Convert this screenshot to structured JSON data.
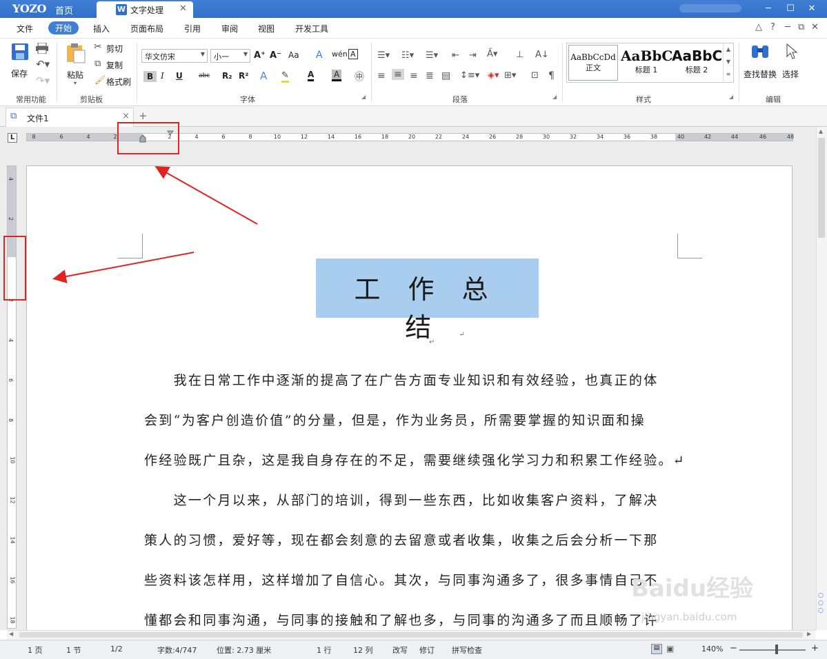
{
  "titlebar": {
    "logo": "YOZO",
    "home": "首页",
    "app_tab": "文字处理",
    "win_min": "─",
    "win_max": "☐",
    "win_close": "✕",
    "w_icon": "W"
  },
  "menubar": {
    "items": [
      "文件",
      "开始",
      "插入",
      "页面布局",
      "引用",
      "审阅",
      "视图",
      "开发工具"
    ],
    "active": "开始",
    "right": [
      "△",
      "?",
      "─",
      "⧉",
      "✕"
    ]
  },
  "ribbon": {
    "common": {
      "save": "保存",
      "group": "常用功能"
    },
    "clipboard": {
      "paste": "粘贴",
      "cut": "剪切",
      "copy": "复制",
      "format_painter": "格式刷",
      "group": "剪贴板"
    },
    "font": {
      "font_name": "华文仿宋",
      "font_size": "小一",
      "group": "字体",
      "bold": "B",
      "italic": "I",
      "underline": "U",
      "strike": "abc",
      "sub": "R₂",
      "sup": "R²",
      "grow": "A⁺",
      "shrink": "A⁻",
      "case": "Aa",
      "pinyin": "wén",
      "border": "A",
      "font_color": "A",
      "highlight": "A",
      "effect": "A"
    },
    "paragraph": {
      "group": "段落"
    },
    "styles": {
      "group": "样式",
      "items": [
        {
          "preview": "AaBbCcDd",
          "name": "正文"
        },
        {
          "preview": "AaBbC",
          "name": "标题 1"
        },
        {
          "preview": "AaBbC",
          "name": "标题 2"
        }
      ]
    },
    "edit": {
      "find": "查找替换",
      "select": "选择",
      "group": "编辑"
    }
  },
  "doctab": {
    "name": "文件1",
    "close": "×",
    "add": "+"
  },
  "ruler": {
    "corner": "L",
    "h_ticks": [
      "8",
      "6",
      "4",
      "2",
      "2",
      "4",
      "6",
      "8",
      "10",
      "12",
      "14",
      "16",
      "18",
      "20",
      "22",
      "24",
      "26",
      "28",
      "30",
      "32",
      "34",
      "36",
      "38",
      "40",
      "42",
      "44",
      "46",
      "48"
    ],
    "v_ticks": [
      "4",
      "2",
      "2",
      "4",
      "6",
      "8",
      "10",
      "12",
      "14",
      "16",
      "18"
    ]
  },
  "document": {
    "title": "工作总结",
    "empty_mark": "↵",
    "lines": [
      "　　我在日常工作中逐渐的提高了在广告方面专业知识和有效经验，也真正的体",
      "会到“为客户创造价值”的分量，但是，作为业务员，所需要掌握的知识面和操",
      "作经验既广且杂，这是我自身存在的不足，需要继续强化学习力和积累工作经验。↵",
      "　　这一个月以来，从部门的培训，得到一些东西，比如收集客户资料，了解决",
      "策人的习惯，爱好等，现在都会刻意的去留意或者收集，收集之后会分析一下那",
      "些资料该怎样用，这样增加了自信心。其次，与同事沟通多了，很多事情自己不",
      "懂都会和同事沟通，与同事的接触和了解也多，与同事的沟通多了而且顺畅了许"
    ]
  },
  "status": {
    "page": "1 页",
    "section": "1 节",
    "pages": "1/2",
    "words": "字数:4/747",
    "position": "位置: 2.73 厘米",
    "row": "1 行",
    "col": "12 列",
    "overwrite": "改写",
    "revise": "修订",
    "spell": "拼写检查",
    "zoom": "140%",
    "zoom_minus": "−",
    "zoom_plus": "+"
  },
  "watermark": {
    "brand": "Baidu经验",
    "url": "jingyan.baidu.com"
  },
  "colors": {
    "accent": "#3f7fd4",
    "highlight": "#a8cdee",
    "annotation": "#e02424"
  }
}
